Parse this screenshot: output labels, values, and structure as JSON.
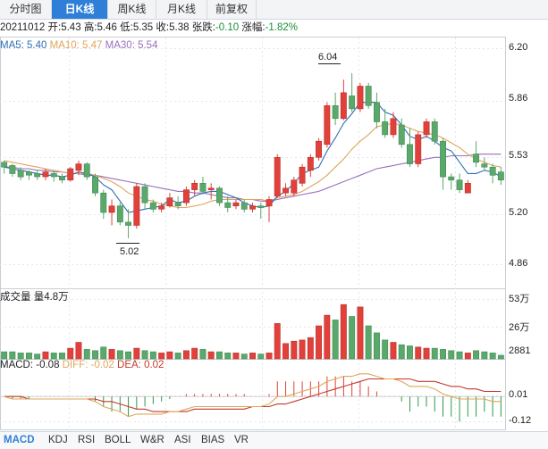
{
  "tabs": [
    {
      "label": "分时图",
      "active": false
    },
    {
      "label": "日K线",
      "active": true
    },
    {
      "label": "周K线",
      "active": false
    },
    {
      "label": "月K线",
      "active": false
    },
    {
      "label": "前复权",
      "active": false
    }
  ],
  "info": {
    "date": "20211012",
    "open_label": "开:",
    "open": "5.43",
    "high_label": "高:",
    "high": "5.46",
    "low_label": "低:",
    "low": "5.35",
    "close_label": "收:",
    "close": "5.38",
    "change_label": "张跌:",
    "change": "-0.10",
    "pct_label": "涨幅:",
    "pct": "-1.82%"
  },
  "ma_legend": {
    "ma5": "MA5: 5.40",
    "ma10": "MA10: 5.47",
    "ma30": "MA30: 5.54"
  },
  "price_axis": [
    "6.20",
    "5.86",
    "5.53",
    "5.20",
    "4.86"
  ],
  "annotations": {
    "high": "6.04",
    "low": "5.02"
  },
  "volume": {
    "legend": "成交量 量4.8万",
    "axis": [
      "53万",
      "26万",
      "2881"
    ]
  },
  "macd": {
    "legend_macd": "MACD: -0.08",
    "legend_diff": "DIFF: -0.02",
    "legend_dea": "DEA: 0.02",
    "axis": [
      "0.01",
      "-0.12"
    ]
  },
  "indicator_tabs": [
    {
      "label": "MACD",
      "active": true
    },
    {
      "label": "KDJ",
      "active": false
    },
    {
      "label": "RSI",
      "active": false
    },
    {
      "label": "BOLL",
      "active": false
    },
    {
      "label": "W&R",
      "active": false
    },
    {
      "label": "ASI",
      "active": false
    },
    {
      "label": "BIAS",
      "active": false
    },
    {
      "label": "VR",
      "active": false
    }
  ],
  "colors": {
    "up": "#e2403a",
    "down": "#5aa96b",
    "ma5": "#2b6fb5",
    "ma10": "#e1a55a",
    "ma30": "#9a6fbd",
    "diff": "#e1a55a",
    "dea": "#c0392b",
    "accent": "#2f7fd8",
    "grid": "#c9ced6"
  },
  "chart_data": {
    "type": "candlestick",
    "price_range": [
      4.86,
      6.2
    ],
    "candles": [
      [
        5.49,
        5.5,
        5.42,
        5.46
      ],
      [
        5.47,
        5.48,
        5.4,
        5.42
      ],
      [
        5.44,
        5.46,
        5.38,
        5.4
      ],
      [
        5.43,
        5.44,
        5.38,
        5.41
      ],
      [
        5.42,
        5.44,
        5.38,
        5.4
      ],
      [
        5.4,
        5.45,
        5.38,
        5.43
      ],
      [
        5.42,
        5.44,
        5.37,
        5.4
      ],
      [
        5.4,
        5.42,
        5.36,
        5.38
      ],
      [
        5.38,
        5.46,
        5.37,
        5.45
      ],
      [
        5.44,
        5.5,
        5.41,
        5.48
      ],
      [
        5.48,
        5.49,
        5.38,
        5.4
      ],
      [
        5.4,
        5.42,
        5.28,
        5.3
      ],
      [
        5.3,
        5.32,
        5.14,
        5.18
      ],
      [
        5.18,
        5.26,
        5.1,
        5.22
      ],
      [
        5.22,
        5.24,
        5.1,
        5.12
      ],
      [
        5.12,
        5.2,
        5.02,
        5.1
      ],
      [
        5.1,
        5.36,
        5.08,
        5.34
      ],
      [
        5.34,
        5.36,
        5.2,
        5.24
      ],
      [
        5.24,
        5.26,
        5.18,
        5.2
      ],
      [
        5.2,
        5.24,
        5.18,
        5.22
      ],
      [
        5.22,
        5.3,
        5.21,
        5.27
      ],
      [
        5.24,
        5.28,
        5.2,
        5.22
      ],
      [
        5.24,
        5.34,
        5.22,
        5.32
      ],
      [
        5.32,
        5.38,
        5.28,
        5.36
      ],
      [
        5.36,
        5.4,
        5.29,
        5.31
      ],
      [
        5.32,
        5.36,
        5.26,
        5.33
      ],
      [
        5.33,
        5.34,
        5.22,
        5.24
      ],
      [
        5.24,
        5.28,
        5.18,
        5.21
      ],
      [
        5.22,
        5.26,
        5.2,
        5.24
      ],
      [
        5.24,
        5.26,
        5.18,
        5.2
      ],
      [
        5.2,
        5.24,
        5.18,
        5.22
      ],
      [
        5.22,
        5.24,
        5.14,
        5.21
      ],
      [
        5.22,
        5.28,
        5.12,
        5.26
      ],
      [
        5.28,
        5.54,
        5.27,
        5.52
      ],
      [
        5.3,
        5.36,
        5.28,
        5.33
      ],
      [
        5.3,
        5.4,
        5.28,
        5.38
      ],
      [
        5.36,
        5.48,
        5.34,
        5.46
      ],
      [
        5.44,
        5.54,
        5.4,
        5.52
      ],
      [
        5.52,
        5.64,
        5.5,
        5.62
      ],
      [
        5.6,
        5.86,
        5.58,
        5.84
      ],
      [
        5.84,
        5.92,
        5.72,
        5.76
      ],
      [
        5.76,
        6.0,
        5.75,
        5.92
      ],
      [
        5.9,
        6.04,
        5.8,
        5.82
      ],
      [
        5.82,
        5.98,
        5.8,
        5.96
      ],
      [
        5.96,
        5.98,
        5.82,
        5.84
      ],
      [
        5.86,
        5.92,
        5.7,
        5.74
      ],
      [
        5.74,
        5.82,
        5.64,
        5.66
      ],
      [
        5.66,
        5.8,
        5.64,
        5.76
      ],
      [
        5.72,
        5.76,
        5.58,
        5.6
      ],
      [
        5.6,
        5.7,
        5.46,
        5.48
      ],
      [
        5.48,
        5.68,
        5.46,
        5.66
      ],
      [
        5.66,
        5.76,
        5.64,
        5.74
      ],
      [
        5.74,
        5.76,
        5.6,
        5.62
      ],
      [
        5.62,
        5.64,
        5.32,
        5.4
      ],
      [
        5.4,
        5.42,
        5.32,
        5.38
      ],
      [
        5.38,
        5.42,
        5.3,
        5.32
      ],
      [
        5.3,
        5.38,
        5.3,
        5.36
      ],
      [
        5.54,
        5.62,
        5.46,
        5.49
      ],
      [
        5.48,
        5.52,
        5.44,
        5.46
      ],
      [
        5.46,
        5.48,
        5.36,
        5.41
      ],
      [
        5.43,
        5.46,
        5.35,
        5.38
      ]
    ],
    "ma5": [
      5.46,
      5.45,
      5.44,
      5.43,
      5.42,
      5.41,
      5.41,
      5.4,
      5.41,
      5.43,
      5.42,
      5.4,
      5.35,
      5.32,
      5.25,
      5.18,
      5.19,
      5.2,
      5.21,
      5.22,
      5.26,
      5.24,
      5.25,
      5.28,
      5.3,
      5.31,
      5.31,
      5.29,
      5.27,
      5.24,
      5.22,
      5.21,
      5.22,
      5.28,
      5.31,
      5.36,
      5.42,
      5.44,
      5.46,
      5.56,
      5.64,
      5.73,
      5.79,
      5.86,
      5.86,
      5.86,
      5.8,
      5.78,
      5.72,
      5.65,
      5.63,
      5.65,
      5.62,
      5.58,
      5.56,
      5.49,
      5.42,
      5.42,
      5.44,
      5.43,
      5.4
    ],
    "ma10": [
      5.5,
      5.49,
      5.48,
      5.47,
      5.46,
      5.45,
      5.44,
      5.43,
      5.42,
      5.42,
      5.42,
      5.41,
      5.39,
      5.37,
      5.34,
      5.3,
      5.28,
      5.26,
      5.25,
      5.23,
      5.22,
      5.21,
      5.21,
      5.22,
      5.23,
      5.25,
      5.26,
      5.26,
      5.26,
      5.26,
      5.26,
      5.26,
      5.25,
      5.27,
      5.28,
      5.29,
      5.31,
      5.34,
      5.37,
      5.41,
      5.46,
      5.51,
      5.57,
      5.62,
      5.66,
      5.71,
      5.72,
      5.73,
      5.72,
      5.7,
      5.68,
      5.67,
      5.66,
      5.64,
      5.61,
      5.58,
      5.54,
      5.51,
      5.49,
      5.47,
      5.46
    ],
    "ma30": [
      5.46,
      5.46,
      5.45,
      5.45,
      5.44,
      5.44,
      5.43,
      5.43,
      5.42,
      5.42,
      5.41,
      5.41,
      5.4,
      5.39,
      5.38,
      5.37,
      5.36,
      5.35,
      5.34,
      5.33,
      5.32,
      5.31,
      5.31,
      5.3,
      5.3,
      5.29,
      5.28,
      5.27,
      5.27,
      5.26,
      5.26,
      5.25,
      5.25,
      5.26,
      5.27,
      5.28,
      5.29,
      5.3,
      5.31,
      5.33,
      5.35,
      5.37,
      5.39,
      5.41,
      5.43,
      5.45,
      5.46,
      5.47,
      5.48,
      5.49,
      5.5,
      5.51,
      5.52,
      5.52,
      5.53,
      5.53,
      5.53,
      5.54,
      5.54,
      5.54,
      5.54
    ],
    "volume_range": [
      0,
      53
    ],
    "volume": [
      6,
      6,
      5,
      5,
      4,
      6,
      5,
      5,
      9,
      14,
      8,
      7,
      10,
      8,
      7,
      6,
      9,
      7,
      6,
      5,
      6,
      5,
      7,
      9,
      8,
      6,
      6,
      5,
      5,
      4,
      5,
      4,
      5,
      30,
      13,
      15,
      16,
      18,
      28,
      37,
      33,
      46,
      36,
      44,
      28,
      22,
      16,
      14,
      12,
      11,
      10,
      9,
      9,
      8,
      7,
      6,
      5,
      7,
      6,
      5,
      3
    ],
    "macd_range": [
      -0.12,
      0.1
    ],
    "diff": [
      0.0,
      -0.01,
      -0.01,
      -0.01,
      -0.01,
      -0.01,
      -0.01,
      -0.01,
      -0.01,
      -0.01,
      -0.01,
      -0.02,
      -0.04,
      -0.05,
      -0.06,
      -0.08,
      -0.07,
      -0.07,
      -0.07,
      -0.07,
      -0.06,
      -0.06,
      -0.05,
      -0.04,
      -0.04,
      -0.04,
      -0.04,
      -0.04,
      -0.04,
      -0.04,
      -0.04,
      -0.04,
      -0.03,
      0.0,
      0.0,
      0.01,
      0.02,
      0.03,
      0.04,
      0.06,
      0.07,
      0.08,
      0.08,
      0.09,
      0.09,
      0.08,
      0.07,
      0.07,
      0.06,
      0.04,
      0.04,
      0.04,
      0.03,
      0.01,
      0.0,
      -0.01,
      -0.01,
      -0.01,
      -0.01,
      -0.02,
      -0.02
    ],
    "dea": [
      0.0,
      0.0,
      0.0,
      -0.01,
      -0.01,
      -0.01,
      -0.01,
      -0.01,
      -0.01,
      -0.01,
      -0.01,
      -0.01,
      -0.02,
      -0.02,
      -0.03,
      -0.04,
      -0.05,
      -0.05,
      -0.06,
      -0.06,
      -0.06,
      -0.06,
      -0.06,
      -0.05,
      -0.05,
      -0.05,
      -0.05,
      -0.05,
      -0.05,
      -0.05,
      -0.04,
      -0.04,
      -0.04,
      -0.03,
      -0.03,
      -0.02,
      -0.01,
      0.0,
      0.01,
      0.02,
      0.03,
      0.04,
      0.05,
      0.06,
      0.07,
      0.07,
      0.07,
      0.07,
      0.07,
      0.07,
      0.06,
      0.06,
      0.06,
      0.05,
      0.04,
      0.04,
      0.03,
      0.03,
      0.02,
      0.02,
      0.02
    ],
    "macd": [
      0.0,
      -0.01,
      -0.01,
      -0.01,
      0.0,
      0.0,
      0.0,
      0.0,
      0.0,
      0.0,
      0.0,
      -0.02,
      -0.04,
      -0.06,
      -0.06,
      -0.08,
      -0.05,
      -0.04,
      -0.03,
      -0.02,
      -0.01,
      0.0,
      0.01,
      0.01,
      0.01,
      0.01,
      0.01,
      0.01,
      0.01,
      0.01,
      0.0,
      0.0,
      0.01,
      0.06,
      0.06,
      0.06,
      0.06,
      0.06,
      0.06,
      0.08,
      0.08,
      0.08,
      0.06,
      0.06,
      0.04,
      0.02,
      0.0,
      0.0,
      -0.02,
      -0.06,
      -0.04,
      -0.04,
      -0.06,
      -0.08,
      -0.08,
      -0.1,
      -0.08,
      -0.08,
      -0.06,
      -0.08,
      -0.08
    ]
  }
}
